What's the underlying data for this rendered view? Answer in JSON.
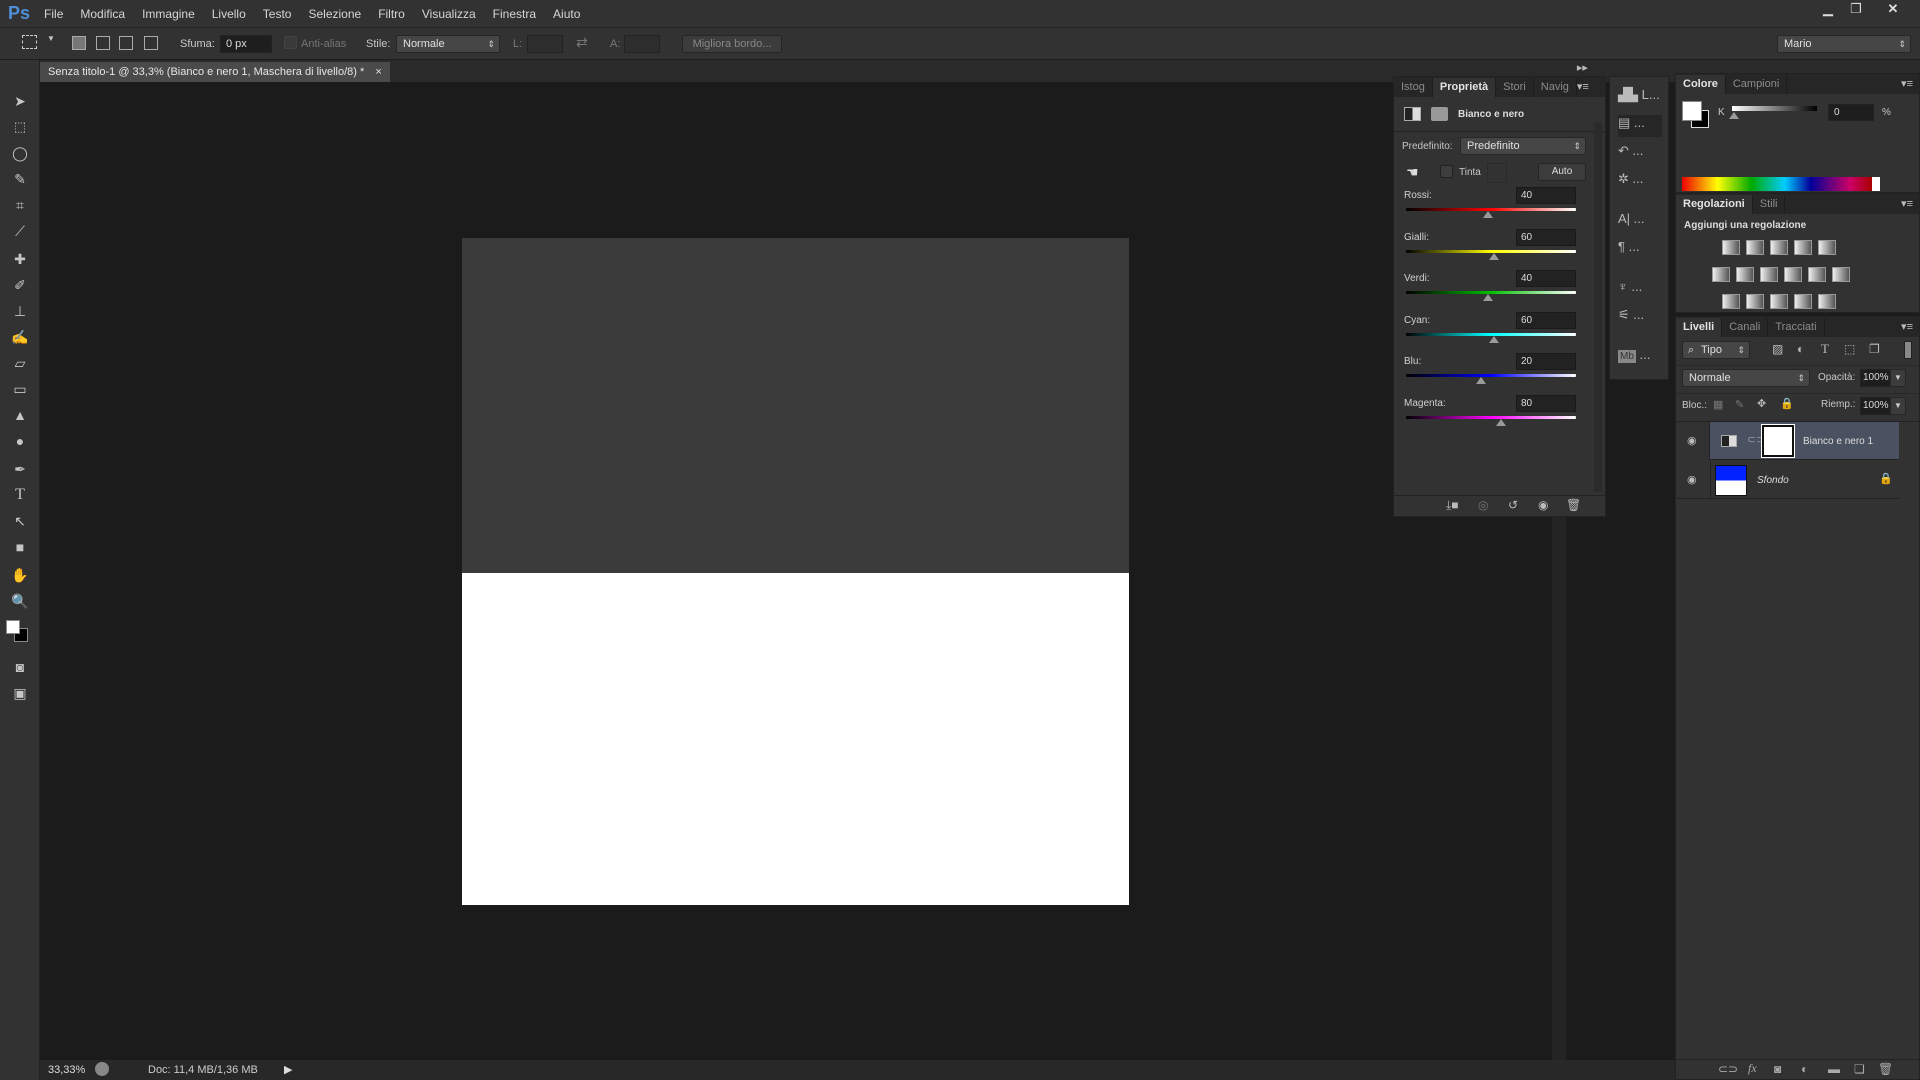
{
  "app": {
    "logo": "Ps",
    "menu": [
      "File",
      "Modifica",
      "Immagine",
      "Livello",
      "Testo",
      "Selezione",
      "Filtro",
      "Visualizza",
      "Finestra",
      "Aiuto"
    ],
    "window_controls": [
      "minimize",
      "restore",
      "close"
    ]
  },
  "options": {
    "feather_label": "Sfuma:",
    "feather_value": "0 px",
    "antialias_label": "Anti-alias",
    "style_label": "Stile:",
    "style_value": "Normale",
    "width_label": "L:",
    "height_label": "A:",
    "refine_edge": "Migliora bordo...",
    "workspace": "Mario"
  },
  "document": {
    "tab_title": "Senza titolo-1 @ 33,3% (Bianco e nero 1, Maschera di livello/8) *",
    "close": "×"
  },
  "status": {
    "zoom": "33,33%",
    "doc_info": "Doc: 11,4 MB/1,36 MB"
  },
  "properties": {
    "tabs": [
      "Istog",
      "Proprietà",
      "Stori",
      "Navig"
    ],
    "title": "Bianco e nero",
    "preset_label": "Predefinito:",
    "preset_value": "Predefinito",
    "tint_label": "Tinta",
    "auto_label": "Auto",
    "sliders": [
      {
        "label": "Rossi:",
        "value": "40",
        "num": 40,
        "gradient": "linear-gradient(90deg,#000,#ff0000,#fff)"
      },
      {
        "label": "Gialli:",
        "value": "60",
        "num": 60,
        "gradient": "linear-gradient(90deg,#000,#ffff00,#fff)"
      },
      {
        "label": "Verdi:",
        "value": "40",
        "num": 40,
        "gradient": "linear-gradient(90deg,#000,#00c000,#fff)"
      },
      {
        "label": "Cyan:",
        "value": "60",
        "num": 60,
        "gradient": "linear-gradient(90deg,#000,#00ffff,#fff)"
      },
      {
        "label": "Blu:",
        "value": "20",
        "num": 20,
        "gradient": "linear-gradient(90deg,#000,#0000ff,#fff)"
      },
      {
        "label": "Magenta:",
        "value": "80",
        "num": 80,
        "gradient": "linear-gradient(90deg,#000,#ff00ff,#fff)"
      }
    ],
    "slider_range": [
      -200,
      300
    ]
  },
  "dock": {
    "items": [
      "L...",
      "...",
      "...",
      "...",
      "...",
      "...",
      "...",
      "...",
      "..."
    ],
    "mb": "Mb"
  },
  "color_panel": {
    "tabs": [
      "Colore",
      "Campioni"
    ],
    "channel": "K",
    "value": "0",
    "unit": "%"
  },
  "adjustments": {
    "tabs": [
      "Regolazioni",
      "Stili"
    ],
    "heading": "Aggiungi una regolazione"
  },
  "layers": {
    "tabs": [
      "Livelli",
      "Canali",
      "Tracciati"
    ],
    "filter": "Tipo",
    "blend": "Normale",
    "opacity_label": "Opacità:",
    "opacity": "100%",
    "lock_label": "Bloc.:",
    "fill_label": "Riemp.:",
    "fill": "100%",
    "items": [
      {
        "name": "Bianco e nero 1",
        "selected": true
      },
      {
        "name": "Sfondo",
        "selected": false
      }
    ]
  }
}
